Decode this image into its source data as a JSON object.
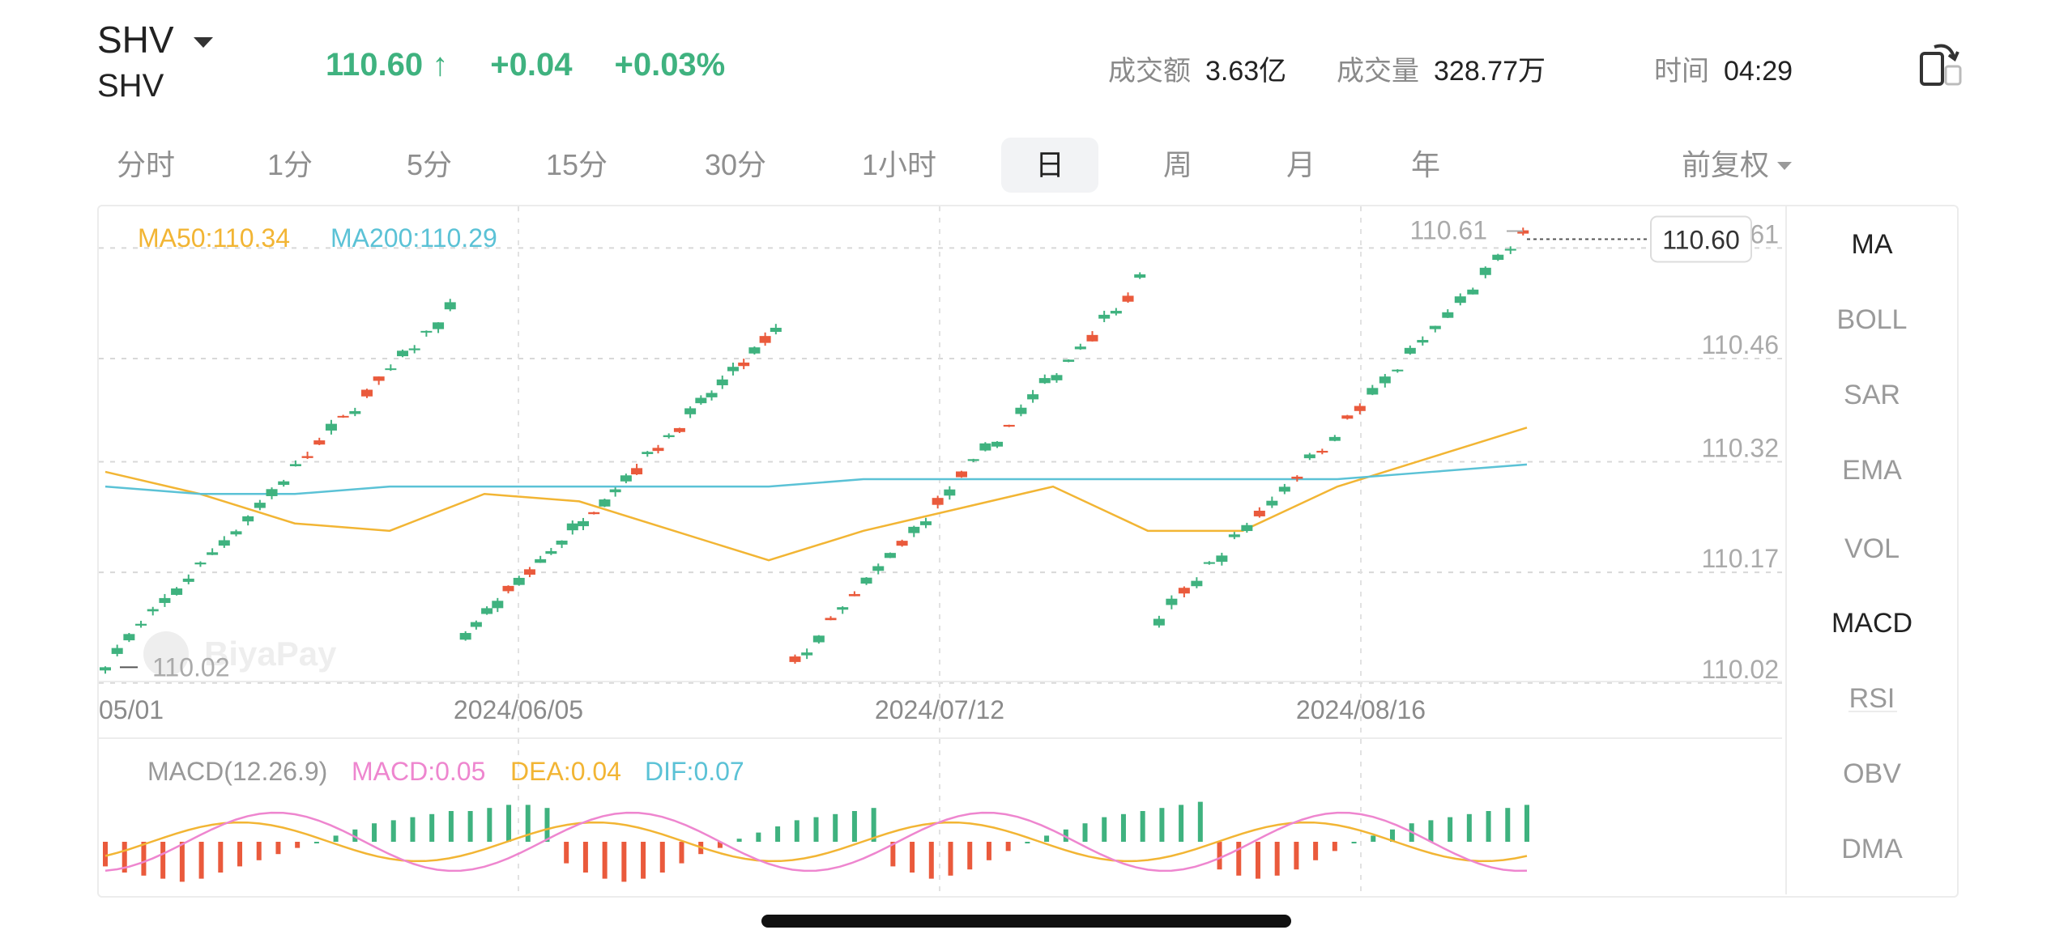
{
  "header": {
    "ticker": "SHV",
    "name": "SHV",
    "price": "110.60 ↑",
    "change": "+0.04",
    "change_pct": "+0.03%",
    "turnover_label": "成交额",
    "turnover_value": "3.63亿",
    "volume_label": "成交量",
    "volume_value": "328.77万",
    "time_label": "时间",
    "time_value": "04:29"
  },
  "tabs": [
    "分时",
    "1分",
    "5分",
    "15分",
    "30分",
    "1小时",
    "日",
    "周",
    "月",
    "年"
  ],
  "active_tab": "日",
  "adjust_label": "前复权",
  "indicators": [
    "MA",
    "BOLL",
    "SAR",
    "EMA",
    "VOL",
    "MACD",
    "RSI",
    "OBV",
    "DMA"
  ],
  "active_indicators": [
    "MA",
    "MACD"
  ],
  "watermark": "BiyaPay",
  "colors": {
    "up": "#3fb27f",
    "down": "#ea5a3c",
    "ma50": "#f2b534",
    "ma200": "#5bc2d6",
    "macd": "#ee86cf",
    "dea": "#f2b534",
    "dif": "#5bc2d6"
  },
  "chart_data": [
    {
      "type": "candlestick",
      "legend": [
        "MA50:110.34",
        "MA200:110.29"
      ],
      "y_ticks": [
        "110.61",
        "110.46",
        "110.32",
        "110.17",
        "110.02"
      ],
      "ylim": [
        110.0,
        110.64
      ],
      "x_ticks": [
        "05/01",
        "2024/06/05",
        "2024/07/12",
        "2024/08/16"
      ],
      "high_marker": "110.61",
      "low_marker": "110.02",
      "last_price": "110.60",
      "series": [
        {
          "name": "MA50",
          "values": [
            110.28,
            110.25,
            110.21,
            110.2,
            110.25,
            110.24,
            110.2,
            110.16,
            110.2,
            110.23,
            110.26,
            110.2,
            110.2,
            110.26,
            110.3,
            110.34
          ]
        },
        {
          "name": "MA200",
          "values": [
            110.26,
            110.25,
            110.25,
            110.26,
            110.26,
            110.26,
            110.26,
            110.26,
            110.27,
            110.27,
            110.27,
            110.27,
            110.27,
            110.27,
            110.28,
            110.29
          ]
        }
      ],
      "cycles": [
        {
          "start": 0,
          "end": 90,
          "base": 110.02,
          "top": 110.5
        },
        {
          "start": 94,
          "end": 175,
          "base": 110.06,
          "top": 110.47
        },
        {
          "start": 180,
          "end": 270,
          "base": 110.02,
          "top": 110.54
        },
        {
          "start": 275,
          "end": 370,
          "base": 110.08,
          "top": 110.6
        }
      ]
    },
    {
      "type": "bar",
      "title": "MACD(12.26.9)",
      "legend": [
        "MACD:0.05",
        "DEA:0.04",
        "DIF:0.07"
      ],
      "values": [
        -0.08,
        -0.1,
        -0.11,
        -0.12,
        -0.13,
        -0.12,
        -0.1,
        -0.08,
        -0.06,
        -0.04,
        -0.02,
        0.0,
        0.02,
        0.04,
        0.06,
        0.07,
        0.08,
        0.09,
        0.1,
        0.1,
        0.11,
        0.12,
        0.12,
        0.11,
        -0.07,
        -0.1,
        -0.12,
        -0.13,
        -0.12,
        -0.1,
        -0.07,
        -0.04,
        -0.02,
        0.01,
        0.03,
        0.05,
        0.07,
        0.08,
        0.09,
        0.1,
        0.11,
        -0.08,
        -0.1,
        -0.12,
        -0.11,
        -0.09,
        -0.06,
        -0.03,
        0.0,
        0.02,
        0.04,
        0.06,
        0.08,
        0.09,
        0.1,
        0.11,
        0.12,
        0.13,
        -0.09,
        -0.11,
        -0.12,
        -0.11,
        -0.09,
        -0.06,
        -0.03,
        0.0,
        0.02,
        0.04,
        0.06,
        0.07,
        0.08,
        0.09,
        0.1,
        0.11,
        0.12
      ]
    }
  ]
}
